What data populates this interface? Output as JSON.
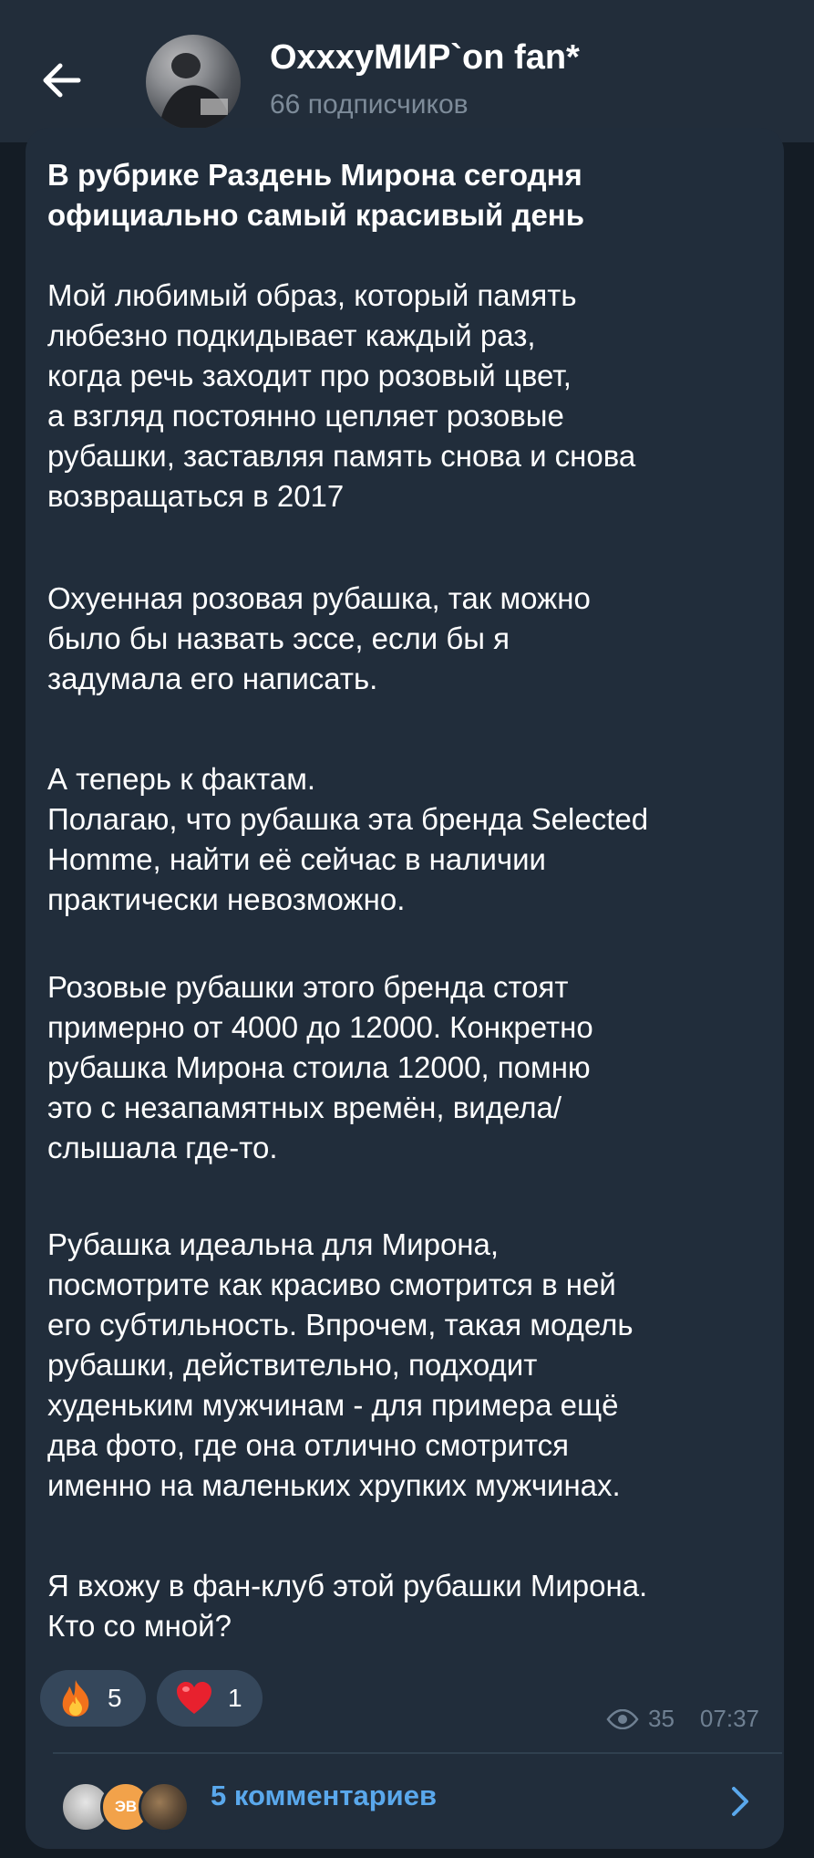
{
  "header": {
    "channel_name": "OxxxyМИР`on fan*",
    "subscribers": "66 подписчиков"
  },
  "post": {
    "title": "В рубрике Раздень Мирона сегодня официально самый красивый день",
    "paragraphs": [
      "Мой любимый образ, который память\nлюбезно подкидывает каждый раз,\nкогда речь заходит про розовый цвет,\nа взгляд  постоянно цепляет розовые\nрубашки, заставляя память снова и снова\nвозвращаться в 2017",
      "Охуенная розовая  рубашка, так можно\nбыло бы назвать эссе, если бы я\nзадумала его написать.",
      "А теперь к фактам.\nПолагаю, что рубашка эта бренда Selected\nHomme, найти её сейчас в наличии\nпрактически невозможно.",
      "Розовые рубашки этого бренда стоят\nпримерно  от 4000 до 12000. Конкретно\nрубашка Мирона стоила 12000, помню\nэто с незапамятных времён, видела/\nслышала где-то.",
      "Рубашка идеальна для Мирона,\nпосмотрите как красиво смотрится в ней\nего субтильность. Впрочем, такая модель\nрубашки, действительно, подходит\nхуденьким мужчинам - для примера ещё\nдва фото, где она отлично смотрится\nименно на маленьких хрупких мужчинах.",
      "Я вхожу в фан-клуб этой рубашки Мирона.\nКто со мной?"
    ],
    "reactions": [
      {
        "icon": "fire-icon",
        "count": "5"
      },
      {
        "icon": "heart-icon",
        "count": "1"
      }
    ],
    "views": "35",
    "time": "07:37",
    "comments_label": "5 комментариев",
    "commenter_initials": "ЭВ"
  },
  "colors": {
    "background": "#141c25",
    "header": "#222d3a",
    "bubble": "#212d3b",
    "accent": "#5aa8ec",
    "reaction_pill": "#35475b"
  }
}
